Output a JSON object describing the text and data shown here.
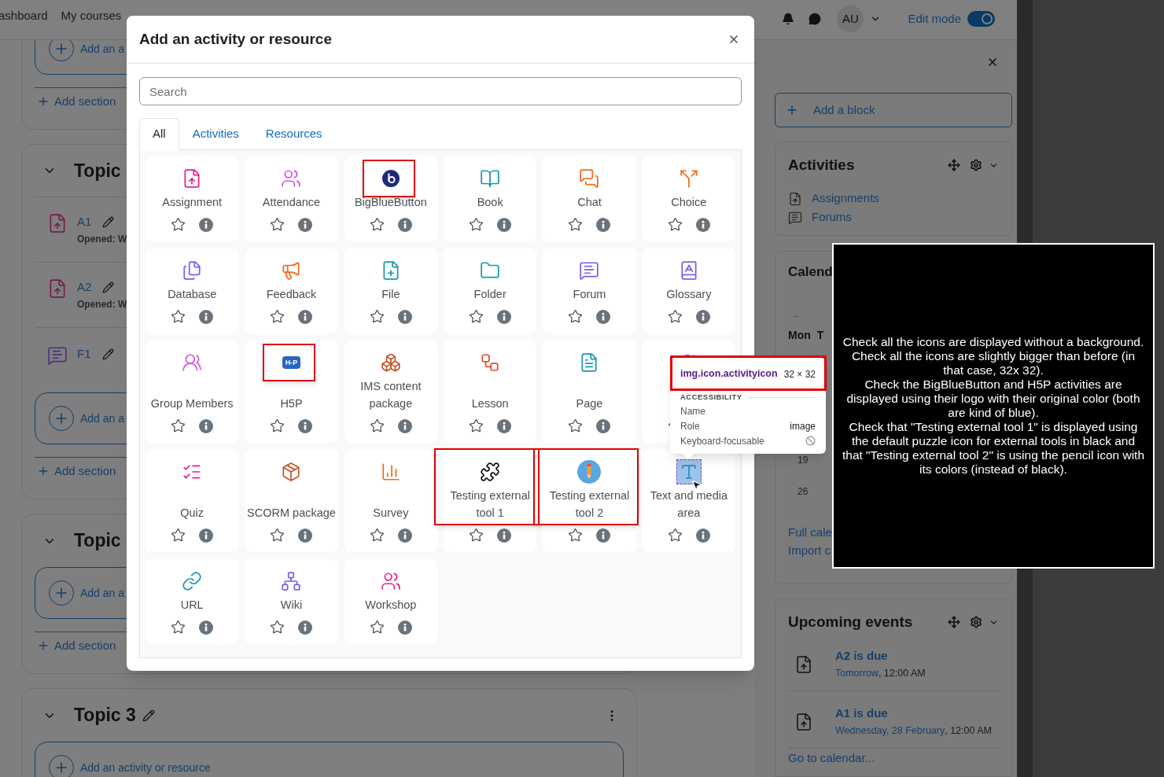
{
  "navbar": {
    "links": [
      "ashboard",
      "My courses"
    ],
    "avatar": "AU",
    "edit_mode": {
      "label": "Edit mode",
      "on": true
    }
  },
  "course": {
    "sections": [
      {
        "kind": "clipped",
        "add_button": "Add an a",
        "add_section": "Add section"
      },
      {
        "kind": "clipped",
        "title": "Topic",
        "items": [
          {
            "kind": "assign",
            "name": "A1",
            "note": "Opened: W"
          },
          {
            "kind": "assign",
            "name": "A2",
            "note": "Opened: W"
          },
          {
            "kind": "forum",
            "name": "F1"
          }
        ],
        "add_button": "Add an a",
        "add_section": "Add section"
      },
      {
        "kind": "clipped",
        "title": "Topic",
        "add_button": "Add an a",
        "add_section": "Add section"
      },
      {
        "kind": "full",
        "title": "Topic 3",
        "add_button": "Add an activity or resource"
      }
    ]
  },
  "modal": {
    "title": "Add an activity or resource",
    "search": {
      "placeholder": "Search"
    },
    "tabs": [
      {
        "label": "All",
        "selected": true
      },
      {
        "label": "Activities",
        "selected": false
      },
      {
        "label": "Resources",
        "selected": false
      }
    ],
    "items": [
      {
        "kind": "assign",
        "name": "Assignment",
        "icon_framed": false,
        "card_framed": false
      },
      {
        "kind": "attendance",
        "name": "Attendance",
        "icon_framed": false,
        "card_framed": false
      },
      {
        "kind": "bbb",
        "name": "BigBlueButton",
        "icon_framed": true,
        "card_framed": false
      },
      {
        "kind": "book",
        "name": "Book",
        "icon_framed": false,
        "card_framed": false
      },
      {
        "kind": "chat",
        "name": "Chat",
        "icon_framed": false,
        "card_framed": false
      },
      {
        "kind": "choice",
        "name": "Choice",
        "icon_framed": false,
        "card_framed": false
      },
      {
        "kind": "database",
        "name": "Database",
        "icon_framed": false,
        "card_framed": false
      },
      {
        "kind": "feedback",
        "name": "Feedback",
        "icon_framed": false,
        "card_framed": false
      },
      {
        "kind": "file",
        "name": "File",
        "icon_framed": false,
        "card_framed": false
      },
      {
        "kind": "folder",
        "name": "Folder",
        "icon_framed": false,
        "card_framed": false
      },
      {
        "kind": "forum",
        "name": "Forum",
        "icon_framed": false,
        "card_framed": false
      },
      {
        "kind": "glossary",
        "name": "Glossary",
        "icon_framed": false,
        "card_framed": false
      },
      {
        "kind": "group",
        "name": "Group Members",
        "icon_framed": false,
        "card_framed": false
      },
      {
        "kind": "h5p",
        "name": "H5P",
        "logo_text": "H-P",
        "icon_framed": true,
        "card_framed": false
      },
      {
        "kind": "ims",
        "name": "IMS content package",
        "icon_framed": false,
        "card_framed": false
      },
      {
        "kind": "lesson",
        "name": "Lesson",
        "icon_framed": false,
        "card_framed": false
      },
      {
        "kind": "page",
        "name": "Page",
        "icon_framed": false,
        "card_framed": false
      },
      {
        "kind": "group",
        "icon_framed": false,
        "card_framed": false
      },
      {
        "kind": "quiz",
        "name": "Quiz",
        "icon_framed": false,
        "card_framed": false
      },
      {
        "kind": "scorm",
        "name": "SCORM package",
        "icon_framed": false,
        "card_framed": false
      },
      {
        "kind": "survey",
        "name": "Survey",
        "icon_framed": false,
        "card_framed": false
      },
      {
        "kind": "lti_puzzle",
        "name": "Testing external tool 1",
        "icon_framed": false,
        "card_framed": true
      },
      {
        "kind": "lti_pencil",
        "name": "Testing external tool 2",
        "icon_framed": false,
        "card_framed": true
      },
      {
        "kind": "text_inspected",
        "name": "Text and media area",
        "icon_framed": false,
        "card_framed": false
      },
      {
        "kind": "url",
        "name": "URL",
        "icon_framed": false,
        "card_framed": false
      },
      {
        "kind": "wiki",
        "name": "Wiki",
        "icon_framed": false,
        "card_framed": false
      },
      {
        "kind": "workshop",
        "name": "Workshop",
        "icon_framed": false,
        "card_framed": false
      }
    ]
  },
  "inspector": {
    "selector": "img.icon.activityicon",
    "size": "32 × 32",
    "section": "ACCESSIBILITY",
    "rows": [
      {
        "label": "Name"
      },
      {
        "label": "Role",
        "value": "image"
      },
      {
        "label": "Keyboard-focusable",
        "kind": "blocked"
      }
    ]
  },
  "drawer": {
    "add_block": "Add a block",
    "activities": {
      "title": "Activities",
      "links": [
        {
          "kind": "assign",
          "label": "Assignments"
        },
        {
          "kind": "forum",
          "label": "Forums"
        }
      ]
    },
    "calendar": {
      "title": "Calend",
      "prev": "←",
      "weekdays": [
        "Mon",
        "T"
      ],
      "days": [
        "19",
        "26"
      ],
      "links": [
        "Full cale",
        "Import c"
      ]
    },
    "upcoming": {
      "title": "Upcoming events",
      "events": [
        {
          "name": "A2 is due",
          "date": "Tomorrow",
          "time": ", 12:00 AM"
        },
        {
          "name": "A1 is due",
          "date": "Wednesday, 28 February",
          "time": ", 12:00 AM"
        }
      ],
      "footer": "Go to calendar..."
    }
  },
  "note": {
    "paragraphs": [
      "Check all the icons are displayed without a background.",
      "Check all the icons are slightly bigger than before (in that case, 32x 32).",
      "Check the BigBlueButton and H5P activities are displayed using their logo with their original color (both are kind of blue).",
      "Check that \"Testing external tool 1\" is displayed using the default puzzle icon for external tools in black and that \"Testing external tool 2\" is using the pencil icon with its colors (instead of black)."
    ]
  }
}
